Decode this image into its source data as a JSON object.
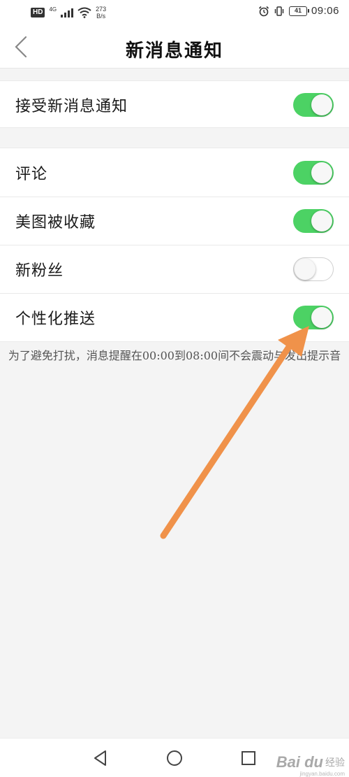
{
  "status_bar": {
    "hd": "HD",
    "network": "4G",
    "speed_value": "273",
    "speed_unit": "B/s",
    "battery": "41",
    "time": "09:06"
  },
  "header": {
    "title": "新消息通知"
  },
  "settings": {
    "main": {
      "label": "接受新消息通知",
      "enabled": true
    },
    "items": [
      {
        "label": "评论",
        "enabled": true
      },
      {
        "label": "美图被收藏",
        "enabled": true
      },
      {
        "label": "新粉丝",
        "enabled": false
      },
      {
        "label": "个性化推送",
        "enabled": true
      }
    ]
  },
  "note": "为了避免打扰，消息提醒在00:00到08:00间不会震动与发出提示音",
  "colors": {
    "toggle_on": "#4cd264",
    "arrow": "#f0924a",
    "background": "#f4f4f4"
  },
  "icons": {
    "back": "chevron-left-icon",
    "nav_back": "triangle-back-icon",
    "nav_home": "circle-home-icon",
    "nav_recent": "square-recent-icon"
  },
  "watermark": {
    "logo": "Bai du",
    "sub": "经验",
    "url": "jingyan.baidu.com"
  }
}
